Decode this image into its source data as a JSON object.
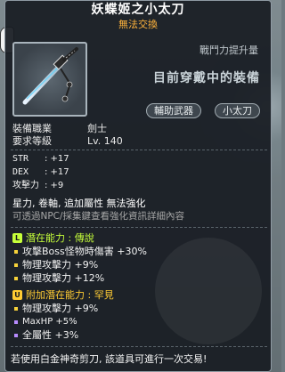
{
  "item": {
    "name": "妖蝶姬之小太刀",
    "trade_status": "無法交換"
  },
  "power_label": "戰鬥力提升量",
  "equipped_text": "目前穿戴中的裝備",
  "chips": [
    "輔助武器",
    "小太刀"
  ],
  "requirements": [
    {
      "label": "裝備職業",
      "value": "劍士"
    },
    {
      "label": "要求等級",
      "value": "Lv. 140"
    }
  ],
  "stats": [
    {
      "label": "STR",
      "value": ": +17"
    },
    {
      "label": "DEX",
      "value": ": +17"
    },
    {
      "label": "攻擊力",
      "value": ": +9"
    }
  ],
  "flags": {
    "line1": "星力, 卷軸, 追加屬性 無法強化",
    "line2": "可透過NPC/採集鍵查看強化資訊詳細內容"
  },
  "potential": {
    "title": "潛在能力 : 傳說",
    "badge": "L",
    "lines": [
      "攻擊Boss怪物時傷害 +30%",
      "物理攻擊力 +9%",
      "物理攻擊力 +12%"
    ]
  },
  "bonus_potential": {
    "title": "附加潛在能力 : 罕見",
    "badge": "U",
    "lines": [
      "物理攻擊力 +9%",
      "MaxHP +5%",
      "全屬性 +3%"
    ]
  },
  "footer": "若使用白金神奇剪刀, 該道具可進行一次交易!",
  "icons": {
    "item": "katana-icon",
    "potential_badge": "legendary-badge-icon",
    "bonus_badge": "unique-badge-icon"
  },
  "colors": {
    "legend_green": "#c6ff3a",
    "unique_yellow": "#ffcc33",
    "trade_orange": "#ffb33c"
  }
}
